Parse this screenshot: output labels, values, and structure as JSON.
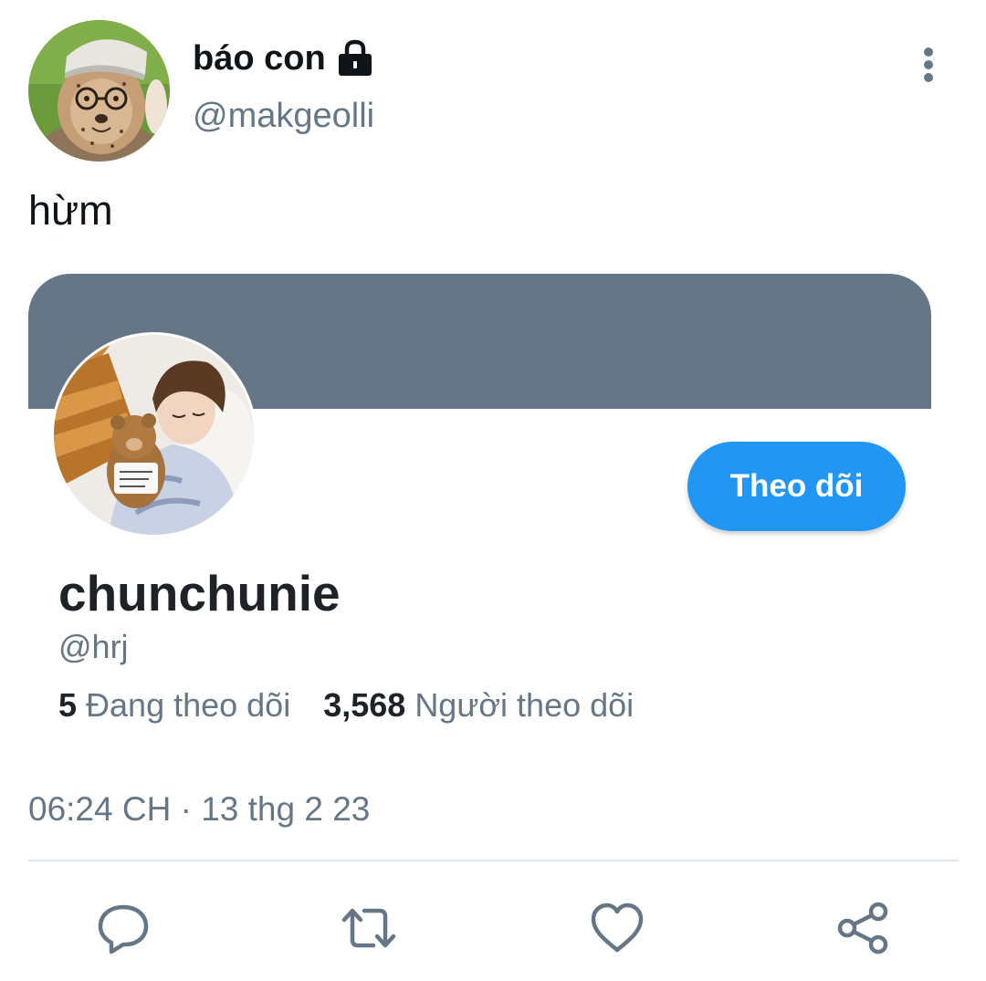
{
  "tweet": {
    "author": {
      "display_name": "báo con",
      "handle": "@makgeolli",
      "avatar_icon": "cheetah-cub-avatar",
      "protected_icon": "lock-icon"
    },
    "more_icon": "more-vertical-icon",
    "text": "hừm",
    "timestamp": "06:24 CH · 13 thg 2 23"
  },
  "profile_card": {
    "banner_color": "#657786",
    "avatar_icon": "profile-photo-avatar",
    "name": "chunchunie",
    "handle": "@hrj",
    "following_count": "5",
    "following_label": "Đang theo dõi",
    "followers_count": "3,568",
    "followers_label": "Người theo dõi",
    "follow_button_label": "Theo dõi",
    "follow_button_color": "#2196f3"
  },
  "actions": [
    {
      "icon": "reply-icon"
    },
    {
      "icon": "retweet-icon"
    },
    {
      "icon": "like-icon"
    },
    {
      "icon": "share-icon"
    }
  ],
  "colors": {
    "text_primary": "#0f1419",
    "text_secondary": "#657786",
    "icon_gray": "#657786",
    "divider": "#e1e8ed"
  }
}
